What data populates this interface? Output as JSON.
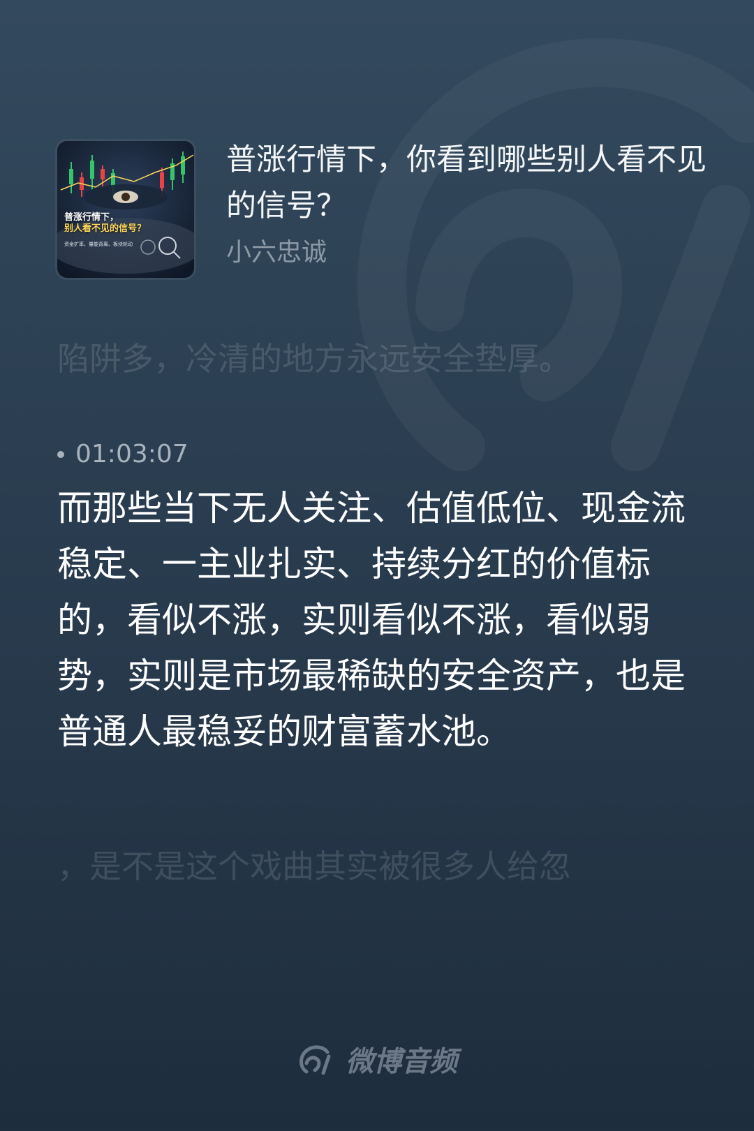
{
  "podcast": {
    "title": "普涨行情下，你看到哪些别人看不见的信号？",
    "author": "小六忠诚",
    "cover": {
      "title_line1": "普涨行情下，",
      "title_line2": "别人看不见的信号？",
      "subtitle": "资金扩率、量能背离、板块轮动"
    }
  },
  "lyrics": {
    "previous": "陷阱多，冷清的地方永远安全垫厚。",
    "timestamp": "01:03:07",
    "current": "而那些当下无人关注、估值低位、现金流稳定、一主业扎实、持续分红的价值标的，看似不涨，实则看似不涨，看似弱势，实则是市场最稀缺的安全资产，也是普通人最稳妥的财富蓄水池。",
    "next": "，是不是这个戏曲其实被很多人给忽"
  },
  "brand": {
    "name": "微博音频",
    "icon": "weibo-audio-logo-icon"
  },
  "colors": {
    "background_top": "#33495d",
    "background_bottom": "#1e2d3d",
    "text_primary": "#ffffff",
    "text_secondary": "#8c99a6",
    "cover_highlight": "#ffd95c"
  }
}
